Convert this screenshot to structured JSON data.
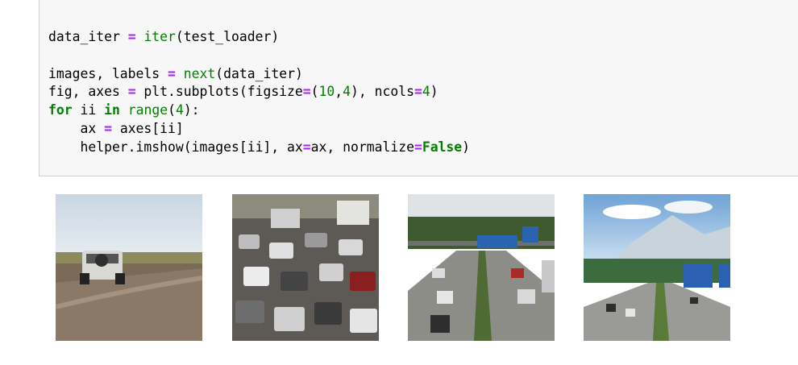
{
  "cell": {
    "lines": [
      [
        {
          "t": "data_iter ",
          "c": ""
        },
        {
          "t": "=",
          "c": "op"
        },
        {
          "t": " ",
          "c": ""
        },
        {
          "t": "iter",
          "c": "fn"
        },
        {
          "t": "(test_loader)",
          "c": ""
        }
      ],
      [],
      [
        {
          "t": "images, labels ",
          "c": ""
        },
        {
          "t": "=",
          "c": "op"
        },
        {
          "t": " ",
          "c": ""
        },
        {
          "t": "next",
          "c": "fn"
        },
        {
          "t": "(data_iter)",
          "c": ""
        }
      ],
      [
        {
          "t": "fig, axes ",
          "c": ""
        },
        {
          "t": "=",
          "c": "op"
        },
        {
          "t": " plt.subplots(figsize",
          "c": ""
        },
        {
          "t": "=",
          "c": "op"
        },
        {
          "t": "(",
          "c": ""
        },
        {
          "t": "10",
          "c": "num"
        },
        {
          "t": ",",
          "c": ""
        },
        {
          "t": "4",
          "c": "num"
        },
        {
          "t": "), ncols",
          "c": ""
        },
        {
          "t": "=",
          "c": "op"
        },
        {
          "t": "4",
          "c": "num"
        },
        {
          "t": ")",
          "c": ""
        }
      ],
      [
        {
          "t": "for",
          "c": "kw"
        },
        {
          "t": " ii ",
          "c": ""
        },
        {
          "t": "in",
          "c": "kw"
        },
        {
          "t": " ",
          "c": ""
        },
        {
          "t": "range",
          "c": "fn"
        },
        {
          "t": "(",
          "c": ""
        },
        {
          "t": "4",
          "c": "num"
        },
        {
          "t": "):",
          "c": ""
        }
      ],
      [
        {
          "t": "    ax ",
          "c": ""
        },
        {
          "t": "=",
          "c": "op"
        },
        {
          "t": " axes[ii]",
          "c": ""
        }
      ],
      [
        {
          "t": "    helper.imshow(images[ii], ax",
          "c": ""
        },
        {
          "t": "=",
          "c": "op"
        },
        {
          "t": "ax, normalize",
          "c": ""
        },
        {
          "t": "=",
          "c": "op"
        },
        {
          "t": "False",
          "c": "kw"
        },
        {
          "t": ")",
          "c": ""
        }
      ]
    ]
  },
  "output": {
    "images": [
      {
        "name": "suv-on-dirt-road-image"
      },
      {
        "name": "traffic-jam-image"
      },
      {
        "name": "highway-signs-image"
      },
      {
        "name": "mountain-highway-image"
      }
    ]
  },
  "colors": {
    "cell_background": "#f7f7f7",
    "cell_border": "#cfcfcf",
    "operator": "#aa22ff",
    "builtin": "#008000",
    "keyword": "#008000",
    "number": "#008000"
  }
}
